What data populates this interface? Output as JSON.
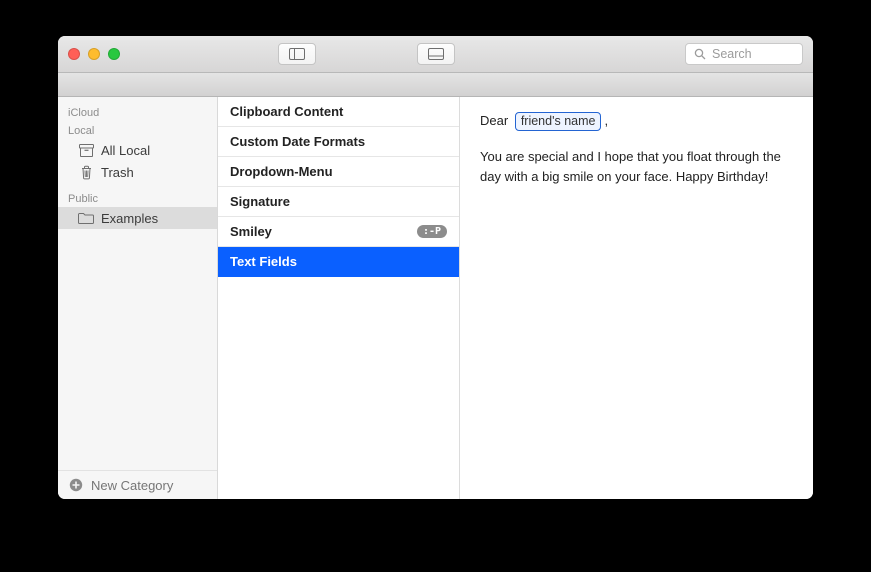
{
  "toolbar": {
    "search_placeholder": "Search"
  },
  "sidebar": {
    "sections": [
      {
        "header": "iCloud",
        "items": []
      },
      {
        "header": "Local",
        "items": [
          {
            "icon": "archive",
            "label": "All Local"
          },
          {
            "icon": "trash",
            "label": "Trash"
          }
        ]
      },
      {
        "header": "Public",
        "items": [
          {
            "icon": "folder",
            "label": "Examples",
            "selected": true
          }
        ]
      }
    ],
    "footer_label": "New Category"
  },
  "list": {
    "items": [
      {
        "label": "Clipboard Content"
      },
      {
        "label": "Custom Date Formats"
      },
      {
        "label": "Dropdown-Menu"
      },
      {
        "label": "Signature"
      },
      {
        "label": "Smiley",
        "badge": ":-P"
      },
      {
        "label": "Text Fields",
        "selected": true
      }
    ]
  },
  "content": {
    "greeting_prefix": "Dear",
    "placeholder_token": "friend's name",
    "greeting_suffix": ",",
    "body": "You are special and I hope that you float through the day with a big smile on your face. Happy Birthday!"
  }
}
